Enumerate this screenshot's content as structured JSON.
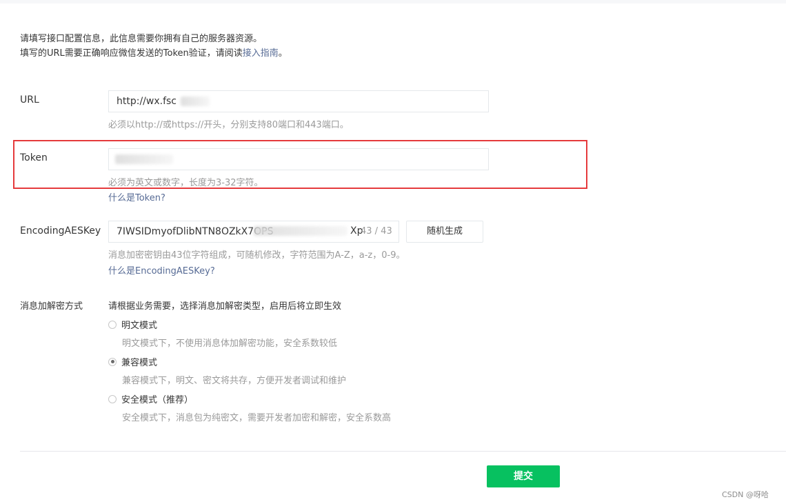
{
  "intro": {
    "line1": "请填写接口配置信息，此信息需要你拥有自己的服务器资源。",
    "line2_prefix": "填写的URL需要正确响应微信发送的Token验证，请阅读",
    "line2_link": "接入指南",
    "line2_suffix": "。"
  },
  "url": {
    "label": "URL",
    "value": "http://wx.fsc",
    "hint": "必须以http://或https://开头，分别支持80端口和443端口。"
  },
  "token": {
    "label": "Token",
    "value": "",
    "hint": "必须为英文或数字，长度为3-32字符。",
    "help_link": "什么是Token?"
  },
  "aes": {
    "label": "EncodingAESKey",
    "value": "7IWSIDmyofDlibNTN8OZkX7OPS",
    "value_tail": "Xp",
    "counter": "43 / 43",
    "generate_label": "随机生成",
    "hint": "消息加密密钥由43位字符组成，可随机修改，字符范围为A-Z，a-z，0-9。",
    "help_link": "什么是EncodingAESKey?"
  },
  "encryption": {
    "label": "消息加解密方式",
    "intro": "请根据业务需要，选择消息加解密类型，启用后将立即生效",
    "options": [
      {
        "label": "明文模式",
        "desc": "明文模式下，不使用消息体加解密功能，安全系数较低",
        "checked": false
      },
      {
        "label": "兼容模式",
        "desc": "兼容模式下，明文、密文将共存，方便开发者调试和维护",
        "checked": true
      },
      {
        "label": "安全模式（推荐）",
        "desc": "安全模式下，消息包为纯密文，需要开发者加密和解密，安全系数高",
        "checked": false
      }
    ]
  },
  "submit_label": "提交",
  "watermark": "CSDN @呀哈"
}
